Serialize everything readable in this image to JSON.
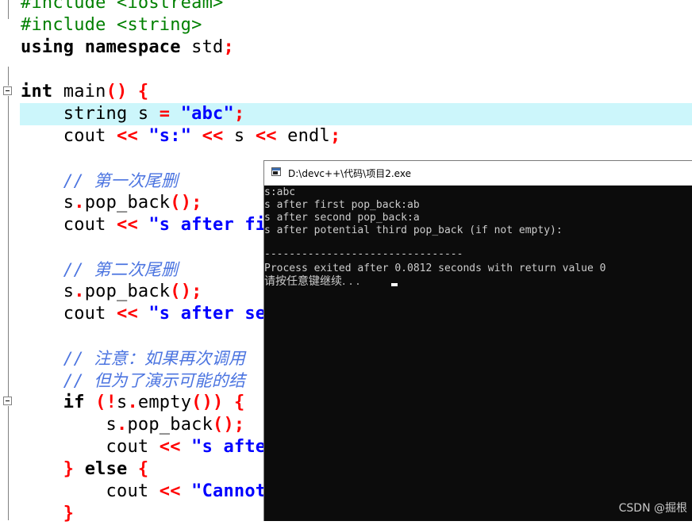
{
  "editor": {
    "lines": {
      "l0": "#include <iostream>",
      "l1": "#include <string>",
      "l2_kw1": "using",
      "l2_kw2": "namespace",
      "l2_rest": " std",
      "l2_semi": ";",
      "l4_kw": "int",
      "l4_rest": " main",
      "l4_paren": "()",
      "l4_brace": "{",
      "l5_a": "    string s ",
      "l5_eq": "=",
      "l5_str": "\"abc\"",
      "l5_semi": ";",
      "l6_a": "    cout ",
      "l6_op1": "<<",
      "l6_str": "\"s:\"",
      "l6_op2": "<<",
      "l6_b": " s ",
      "l6_op3": "<<",
      "l6_c": " endl",
      "l6_semi": ";",
      "l8_slash": "// ",
      "l8_cn": "第一次尾删",
      "l9_a": "    s",
      "l9_dot": ".",
      "l9_b": "pop_back",
      "l9_paren": "();",
      "l10_a": "    cout ",
      "l10_op": "<<",
      "l10_str": "\"s after fir",
      "l12_slash": "// ",
      "l12_cn": "第二次尾删",
      "l13_a": "    s",
      "l13_dot": ".",
      "l13_b": "pop_back",
      "l13_paren": "();",
      "l14_a": "    cout ",
      "l14_op": "<<",
      "l14_str": "\"s after sec",
      "l16_slash": "// ",
      "l16_cn": "注意：如果再次调用",
      "l17_slash": "// ",
      "l17_cn": "但为了演示可能的结",
      "l18_kw": "if",
      "l18_a": " (",
      "l18_bang": "!",
      "l18_b": "s",
      "l18_dot": ".",
      "l18_c": "empty",
      "l18_paren": "())",
      "l18_brace": "{",
      "l19_a": "        s",
      "l19_dot": ".",
      "l19_b": "pop_back",
      "l19_paren": "();",
      "l20_a": "        cout ",
      "l20_op": "<<",
      "l20_str": "\"s after",
      "l21_brace": "}",
      "l21_kw": "else",
      "l21_brace2": "{",
      "l22_a": "        cout ",
      "l22_op": "<<",
      "l22_str": "\"Cannot",
      "l23_brace": "}"
    }
  },
  "console": {
    "title": "D:\\devc++\\代码\\项目2.exe",
    "lines": [
      "s:abc",
      "s after first pop_back:ab",
      "s after second pop_back:a",
      "s after potential third pop_back (if not empty):",
      "",
      "--------------------------------",
      "Process exited after 0.0812 seconds with return value 0",
      "请按任意键继续. . ."
    ]
  },
  "watermark": "CSDN @掘根"
}
